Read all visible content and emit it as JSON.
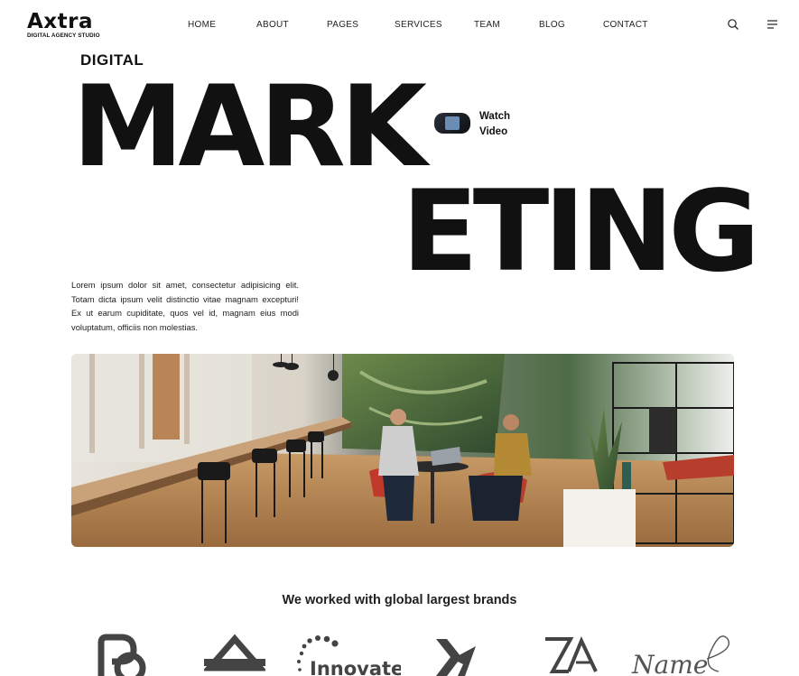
{
  "header": {
    "logo_mark": "Axtra",
    "logo_sub": "DIGITAL AGENCY STUDIO",
    "nav": [
      "HOME",
      "ABOUT",
      "PAGES",
      "SERVICES",
      "TEAM",
      "BLOG",
      "CONTACT"
    ],
    "icons": [
      "search-icon",
      "menu-icon"
    ]
  },
  "hero": {
    "eyebrow": "DIGITAL",
    "title_line1": "MARK",
    "title_line2": "ETING",
    "video_label": "Watch Video",
    "description": "Lorem ipsum dolor sit amet, consectetur adipisicing elit. Totam dicta ipsum velit distinctio vitae magnam excepturi! Ex ut earum cupiditate, quos vel id, magnam eius modi voluptatum, officiis non molestias."
  },
  "brands": {
    "title": "We worked with global largest brands",
    "logos": [
      {
        "name": "brand-rd-logo"
      },
      {
        "name": "brand-triangle-logo"
      },
      {
        "name": "brand-innovate-logo",
        "text": "Innovate"
      },
      {
        "name": "brand-arrow-logo"
      },
      {
        "name": "brand-za-logo"
      },
      {
        "name": "brand-name-script-logo",
        "text": "Name"
      }
    ]
  },
  "colors": {
    "text": "#111111",
    "accent_wood": "#b0743f",
    "accent_chair": "#c0392b",
    "wall_green": "#4d6b45"
  }
}
